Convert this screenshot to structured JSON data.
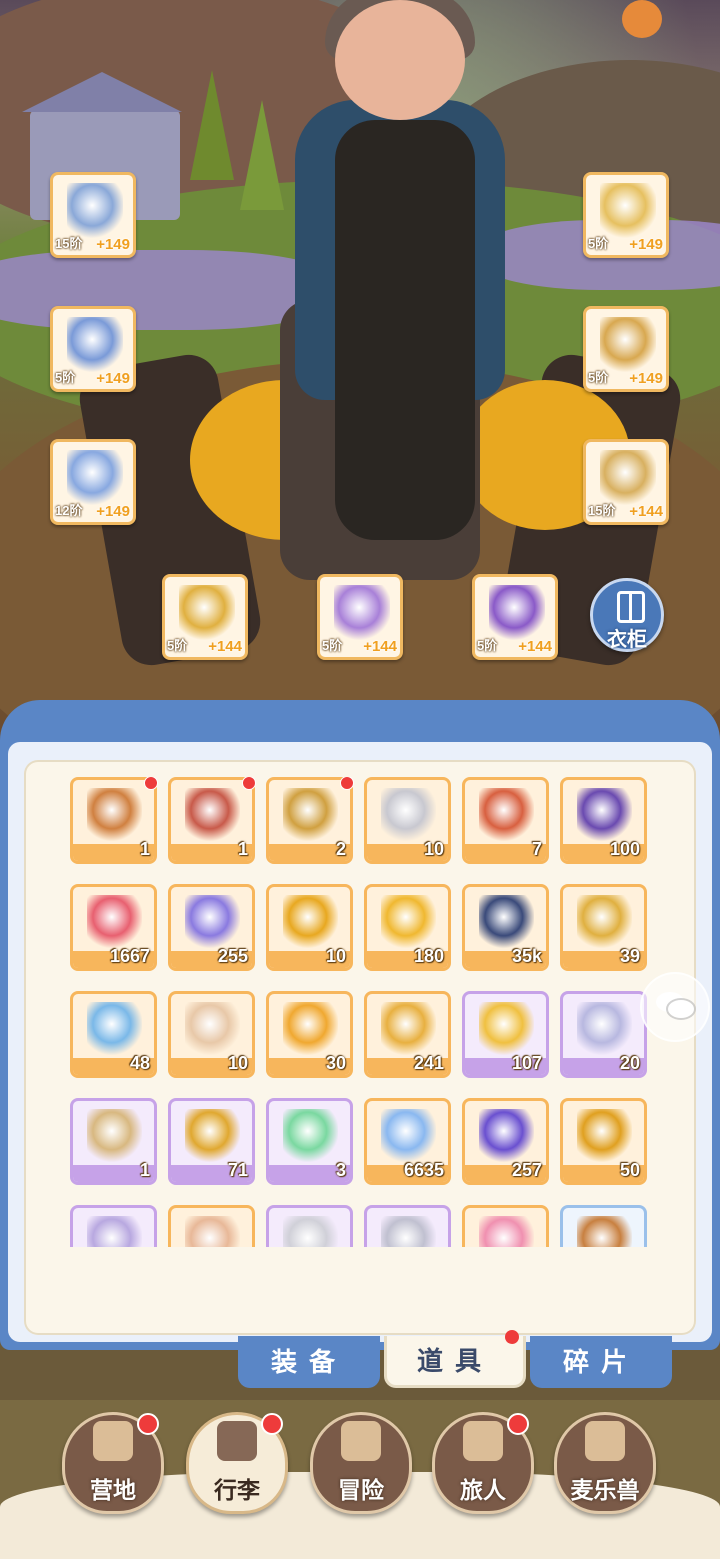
{
  "equipment": [
    {
      "slot": "weapon",
      "icon": "sword-icon",
      "tier": "15阶",
      "bonus": "+149",
      "color": "#8aa8d8"
    },
    {
      "slot": "helmet",
      "icon": "helmet-icon",
      "tier": "5阶",
      "bonus": "+149",
      "color": "#e6c060"
    },
    {
      "slot": "chest",
      "icon": "chest-armor-icon",
      "tier": "5阶",
      "bonus": "+149",
      "color": "#7a9ad8"
    },
    {
      "slot": "gloves",
      "icon": "gloves-icon",
      "tier": "5阶",
      "bonus": "+149",
      "color": "#d8a850"
    },
    {
      "slot": "legs",
      "icon": "leg-armor-icon",
      "tier": "12阶",
      "bonus": "+149",
      "color": "#88a8e0"
    },
    {
      "slot": "boots",
      "icon": "boots-icon",
      "tier": "15阶",
      "bonus": "+144",
      "color": "#d8b060"
    },
    {
      "slot": "ring",
      "icon": "ring-icon",
      "tier": "5阶",
      "bonus": "+144",
      "color": "#e0b040"
    },
    {
      "slot": "necklace",
      "icon": "necklace-icon",
      "tier": "5阶",
      "bonus": "+144",
      "color": "#a880d8"
    },
    {
      "slot": "earring",
      "icon": "earring-icon",
      "tier": "5阶",
      "bonus": "+144",
      "color": "#8a5ac8"
    }
  ],
  "wardrobe": {
    "label": "衣柜",
    "icon": "wardrobe-icon"
  },
  "inventory": {
    "items": [
      {
        "icon": "treasure-chest-icon",
        "count": "1",
        "rarity": "orange",
        "new": true,
        "color": "#d08040"
      },
      {
        "icon": "red-treasure-chest-icon",
        "count": "1",
        "rarity": "orange",
        "new": true,
        "color": "#c85a4a"
      },
      {
        "icon": "gold-treasure-chest-icon",
        "count": "2",
        "rarity": "orange",
        "new": true,
        "color": "#d0a040"
      },
      {
        "icon": "spoon-icon",
        "count": "10",
        "rarity": "orange",
        "new": false,
        "color": "#c8c8d0"
      },
      {
        "icon": "cat-bag-icon",
        "count": "7",
        "rarity": "orange",
        "new": false,
        "color": "#d86040"
      },
      {
        "icon": "purple-ticket-icon",
        "count": "100",
        "rarity": "orange",
        "new": false,
        "color": "#6a4ab0"
      },
      {
        "icon": "red-ticket-icon",
        "count": "1667",
        "rarity": "orange",
        "new": false,
        "color": "#e86070"
      },
      {
        "icon": "paper-plane-icon",
        "count": "255",
        "rarity": "orange",
        "new": false,
        "color": "#8a7ae0"
      },
      {
        "icon": "amber-crystal-icon",
        "count": "10",
        "rarity": "orange",
        "new": false,
        "color": "#e8a820"
      },
      {
        "icon": "star-badge-icon",
        "count": "180",
        "rarity": "orange",
        "new": false,
        "color": "#f0b830"
      },
      {
        "icon": "portal-orb-icon",
        "count": "35k",
        "rarity": "orange",
        "new": false,
        "color": "#3a4a7a"
      },
      {
        "icon": "harp-icon",
        "count": "39",
        "rarity": "orange",
        "new": false,
        "color": "#e0b040"
      },
      {
        "icon": "blue-crystal-icon",
        "count": "48",
        "rarity": "orange",
        "new": false,
        "color": "#7ab8e8"
      },
      {
        "icon": "rainbow-tube-icon",
        "count": "10",
        "rarity": "orange",
        "new": false,
        "color": "#e8c8a8"
      },
      {
        "icon": "outfit-card-icon",
        "count": "30",
        "rarity": "orange",
        "new": false,
        "color": "#f0a830"
      },
      {
        "icon": "bell-icon",
        "count": "241",
        "rarity": "orange",
        "new": false,
        "color": "#e8b040"
      },
      {
        "icon": "paw-cheese-icon",
        "count": "107",
        "rarity": "purple",
        "new": false,
        "color": "#f0c040"
      },
      {
        "icon": "cat-spoon-icon",
        "count": "20",
        "rarity": "purple",
        "new": false,
        "color": "#b8b8e0"
      },
      {
        "icon": "paw-sack-icon",
        "count": "1",
        "rarity": "purple",
        "new": false,
        "color": "#d8b880"
      },
      {
        "icon": "horseshoe-icon",
        "count": "71",
        "rarity": "purple",
        "new": false,
        "color": "#e0a830"
      },
      {
        "icon": "potion-bottle-icon",
        "count": "3",
        "rarity": "purple",
        "new": false,
        "color": "#7ad8a0"
      },
      {
        "icon": "blue-star-icon",
        "count": "6635",
        "rarity": "orange",
        "new": false,
        "color": "#8ab8f0"
      },
      {
        "icon": "purple-gem-icon",
        "count": "257",
        "rarity": "orange",
        "new": false,
        "color": "#6a50d0"
      },
      {
        "icon": "amber-egg-icon",
        "count": "50",
        "rarity": "orange",
        "new": false,
        "color": "#e0a020"
      },
      {
        "icon": "purple-orb-icon",
        "count": "",
        "rarity": "purple",
        "new": false,
        "color": "#b8a8e0"
      },
      {
        "icon": "peach-crystal-icon",
        "count": "",
        "rarity": "orange",
        "new": false,
        "color": "#e8b898"
      },
      {
        "icon": "bottle-icon",
        "count": "",
        "rarity": "purple",
        "new": false,
        "color": "#d0d0d8"
      },
      {
        "icon": "potion-icon",
        "count": "",
        "rarity": "purple",
        "new": false,
        "color": "#c0c0d0"
      },
      {
        "icon": "pink-flower-icon",
        "count": "",
        "rarity": "orange",
        "new": false,
        "color": "#f090b0"
      },
      {
        "icon": "paw-icon",
        "count": "",
        "rarity": "blue",
        "new": false,
        "color": "#c88040"
      }
    ]
  },
  "subtabs": [
    {
      "label": "装备",
      "active": false,
      "new": false
    },
    {
      "label": "道具",
      "active": true,
      "new": true
    },
    {
      "label": "碎片",
      "active": false,
      "new": false
    }
  ],
  "nav": [
    {
      "label": "营地",
      "icon": "castle-icon",
      "active": false,
      "new": true
    },
    {
      "label": "行李",
      "icon": "backpack-icon",
      "active": true,
      "new": true
    },
    {
      "label": "冒险",
      "icon": "crossed-swords-icon",
      "active": false,
      "new": false
    },
    {
      "label": "旅人",
      "icon": "traveler-icon",
      "active": false,
      "new": true
    },
    {
      "label": "麦乐兽",
      "icon": "cat-head-icon",
      "active": false,
      "new": false
    }
  ],
  "colors": {
    "accent": "#5a86c6",
    "orange_rarity": "#f7b65c",
    "purple_rarity": "#c6a2e8",
    "badge": "#ee3b3b"
  }
}
